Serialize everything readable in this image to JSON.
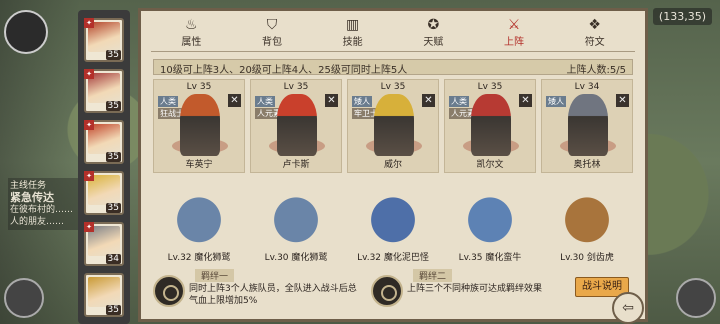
{
  "hud": {
    "coord": "(133,35)"
  },
  "quest": {
    "title": "主线任务",
    "name": "紧急传达",
    "desc": "在彼布村的……人的朋友……"
  },
  "roster": [
    {
      "level": "35",
      "color": "#b2432a"
    },
    {
      "level": "35",
      "color": "#a33b3b"
    },
    {
      "level": "35",
      "color": "#c0452b"
    },
    {
      "level": "35",
      "color": "#d8b23a"
    },
    {
      "level": "34",
      "color": "#7b7f86"
    },
    {
      "level": "35",
      "color": "#c99a35"
    }
  ],
  "tabs": [
    {
      "label": "属性",
      "icon": "flame-icon",
      "glyph": "♨",
      "active": false
    },
    {
      "label": "背包",
      "icon": "bag-icon",
      "glyph": "⛉",
      "active": false
    },
    {
      "label": "技能",
      "icon": "book-icon",
      "glyph": "▥",
      "active": false
    },
    {
      "label": "天赋",
      "icon": "star-icon",
      "glyph": "✪",
      "active": false
    },
    {
      "label": "上阵",
      "icon": "swords-icon",
      "glyph": "⚔",
      "active": true
    },
    {
      "label": "符文",
      "icon": "rune-icon",
      "glyph": "❖",
      "active": false
    }
  ],
  "lineup": {
    "rule": "10级可上阵3人、20级可上阵4人、25级可同时上阵5人",
    "count": "上阵人数:5/5"
  },
  "heroes": [
    {
      "level": "Lv 35",
      "race": "人类",
      "role": "狂战士",
      "name": "车英宁",
      "color": "#c25a2c"
    },
    {
      "level": "Lv 35",
      "race": "人类",
      "role": "人元素",
      "name": "卢卡斯",
      "color": "#c9402c"
    },
    {
      "level": "Lv 35",
      "race": "矮人",
      "role": "牢卫士",
      "name": "威尔",
      "color": "#d7b03a"
    },
    {
      "level": "Lv 35",
      "race": "人类",
      "role": "人元素",
      "name": "凯尔文",
      "color": "#b73a33"
    },
    {
      "level": "Lv 34",
      "race": "矮人",
      "role": "",
      "name": "奥托林",
      "color": "#707580"
    }
  ],
  "pets": [
    {
      "name": "Lv.32 魔化狮鹫",
      "color": "#6a85a8"
    },
    {
      "name": "Lv.30 魔化狮鹫",
      "color": "#6a85a8"
    },
    {
      "name": "Lv.32 魔化泥巴怪",
      "color": "#4e6fa8"
    },
    {
      "name": "Lv.35 魔化蛮牛",
      "color": "#5d82b4"
    },
    {
      "name": "Lv.30 剑齿虎",
      "color": "#a8743c"
    }
  ],
  "bonds": [
    {
      "title": "羁绊一",
      "desc": "同时上阵3个人族队员，全队进入战斗后总气血上限增加5%"
    },
    {
      "title": "羁绊二",
      "desc": "上阵三个不同种族可达成羁绊效果"
    }
  ],
  "battle_info_label": "战斗说明"
}
